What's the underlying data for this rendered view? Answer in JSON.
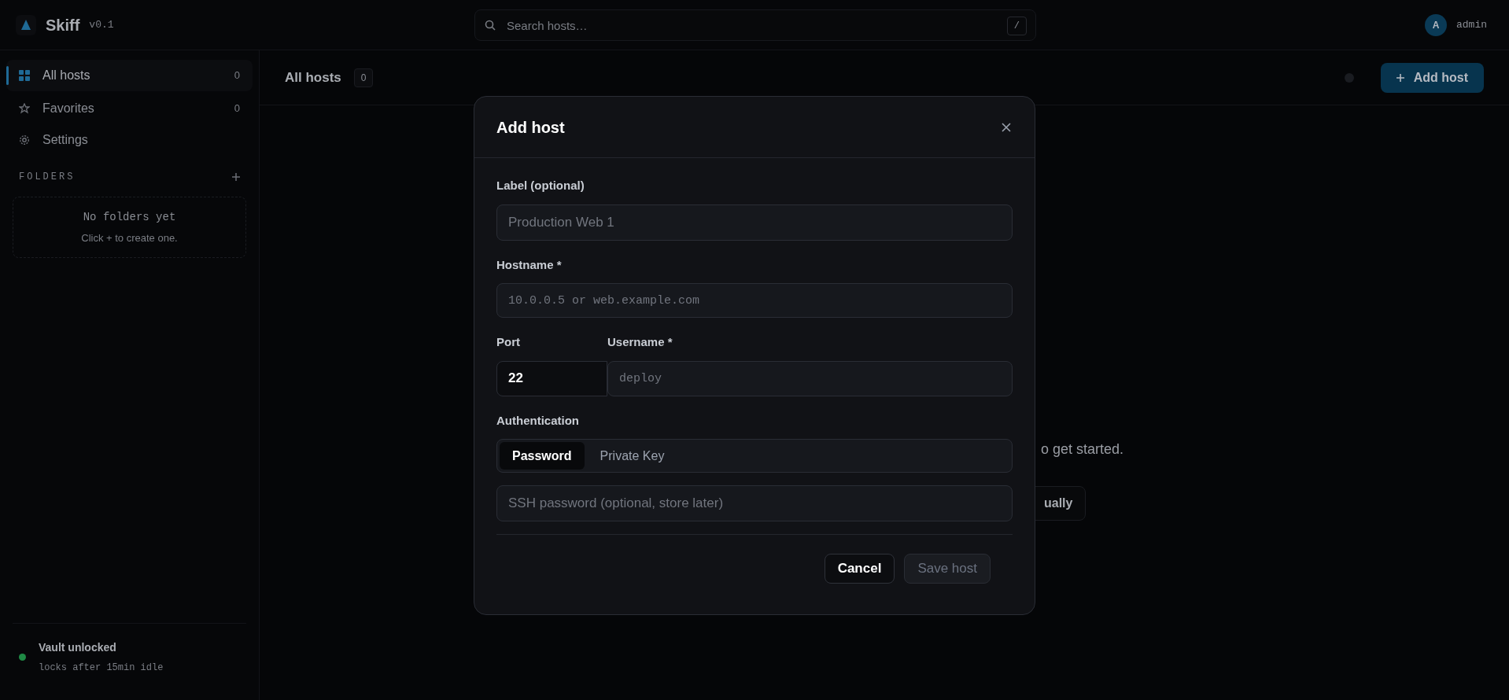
{
  "app": {
    "name": "Skiff",
    "version": "v0.1"
  },
  "search": {
    "placeholder": "Search hosts…",
    "shortcut": "/"
  },
  "user": {
    "initial": "A",
    "name": "admin"
  },
  "sidebar": {
    "items": [
      {
        "kind": "grid",
        "label": "All hosts",
        "count": "0",
        "selected": true
      },
      {
        "kind": "star",
        "label": "Favorites",
        "count": "0",
        "selected": false
      },
      {
        "kind": "gear",
        "label": "Settings",
        "selected": false
      }
    ],
    "folders": {
      "title": "FOLDERS",
      "empty_title": "No folders yet",
      "empty_hint": "Click + to create one."
    },
    "vault": {
      "status": "Vault unlocked",
      "detail": "locks after 15min idle",
      "color": "#1f8a45"
    }
  },
  "main": {
    "title": "All hosts",
    "count": "0",
    "add_button": "Add host",
    "empty_hint": "o get started.",
    "empty_button": "ually"
  },
  "dialog": {
    "title": "Add host",
    "label_field": {
      "label": "Label (optional)",
      "placeholder": "Production Web 1"
    },
    "hostname_field": {
      "label": "Hostname *",
      "placeholder": "10.0.0.5 or web.example.com"
    },
    "port_field": {
      "label": "Port",
      "value": "22"
    },
    "username_field": {
      "label": "Username *",
      "placeholder": "deploy"
    },
    "authentication": {
      "label": "Authentication",
      "options": [
        {
          "label": "Password",
          "selected": true
        },
        {
          "label": "Private Key",
          "selected": false
        }
      ]
    },
    "password_field": {
      "placeholder": "SSH password (optional, store later)"
    },
    "buttons": {
      "cancel": "Cancel",
      "save": {
        "label": "Save host",
        "disabled": true
      }
    }
  }
}
